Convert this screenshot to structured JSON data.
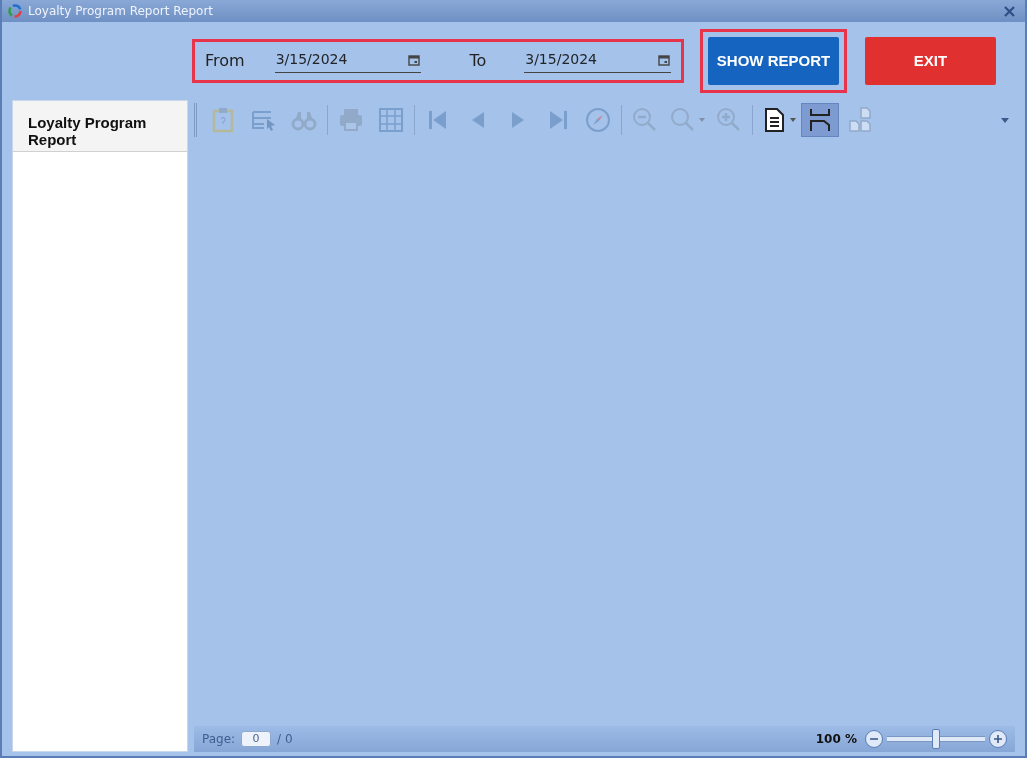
{
  "window": {
    "title": "Loyalty Program Report Report"
  },
  "filters": {
    "from_label": "From",
    "from_value": "3/15/2024",
    "to_label": "To",
    "to_value": "3/15/2024"
  },
  "buttons": [
    {
      "label": "SHOW REPORT",
      "kind": "primary",
      "highlighted": true
    },
    {
      "label": "EXIT",
      "kind": "danger",
      "highlighted": false
    }
  ],
  "sidebar": {
    "items": [
      {
        "label": "Loyalty Program Report",
        "selected": true
      }
    ]
  },
  "toolbar": {
    "groups": [
      [
        {
          "disabled": true,
          "selected": false,
          "dropdown": false
        },
        {
          "disabled": true,
          "selected": false,
          "dropdown": false
        },
        {
          "disabled": true,
          "selected": false,
          "dropdown": false
        }
      ],
      [
        {
          "disabled": true,
          "selected": false,
          "dropdown": false
        },
        {
          "disabled": true,
          "selected": false,
          "dropdown": false
        }
      ],
      [
        {
          "disabled": true,
          "selected": false,
          "dropdown": false
        },
        {
          "disabled": true,
          "selected": false,
          "dropdown": false
        },
        {
          "disabled": true,
          "selected": false,
          "dropdown": false
        },
        {
          "disabled": true,
          "selected": false,
          "dropdown": false
        },
        {
          "disabled": true,
          "selected": false,
          "dropdown": false
        }
      ],
      [
        {
          "disabled": true,
          "selected": false,
          "dropdown": false
        },
        {
          "disabled": true,
          "selected": false,
          "dropdown": true
        },
        {
          "disabled": true,
          "selected": false,
          "dropdown": false
        }
      ],
      [
        {
          "disabled": false,
          "selected": false,
          "dropdown": true
        },
        {
          "disabled": false,
          "selected": true,
          "dropdown": false
        },
        {
          "disabled": true,
          "selected": false,
          "dropdown": false
        }
      ]
    ]
  },
  "status_bar": {
    "page_label": "Page:",
    "page_value": "0",
    "page_total": "/ 0",
    "page_disabled": true,
    "zoom_reading": "100 %",
    "zoom": {
      "level": 0.5
    }
  }
}
